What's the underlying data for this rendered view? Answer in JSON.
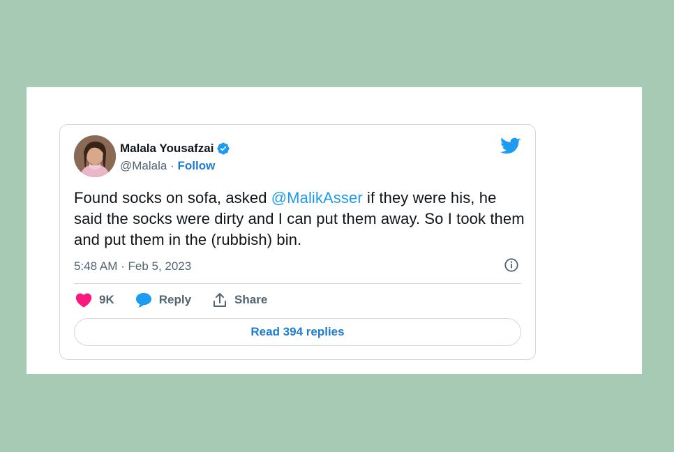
{
  "tweet": {
    "author": {
      "name": "Malala Yousafzai",
      "handle": "@Malala",
      "separator": "·",
      "follow_label": "Follow",
      "avatar_icon": "user-avatar-photo",
      "verified_icon": "verified-badge-icon"
    },
    "text": {
      "part1": "Found socks on sofa, asked ",
      "mention": "@MalikAsser",
      "part2": " if they were his, he said the socks were dirty and I can put them away. So I took them and put them in the (rubbish) bin."
    },
    "timestamp": "5:48 AM · Feb 5, 2023",
    "actions": {
      "like_count": "9K",
      "reply_label": "Reply",
      "share_label": "Share"
    },
    "read_replies_label": "Read 394 replies"
  },
  "colors": {
    "background": "#a7cab5",
    "accent": "#1d9bf0",
    "link": "#1d7bd2",
    "like": "#f91880"
  }
}
